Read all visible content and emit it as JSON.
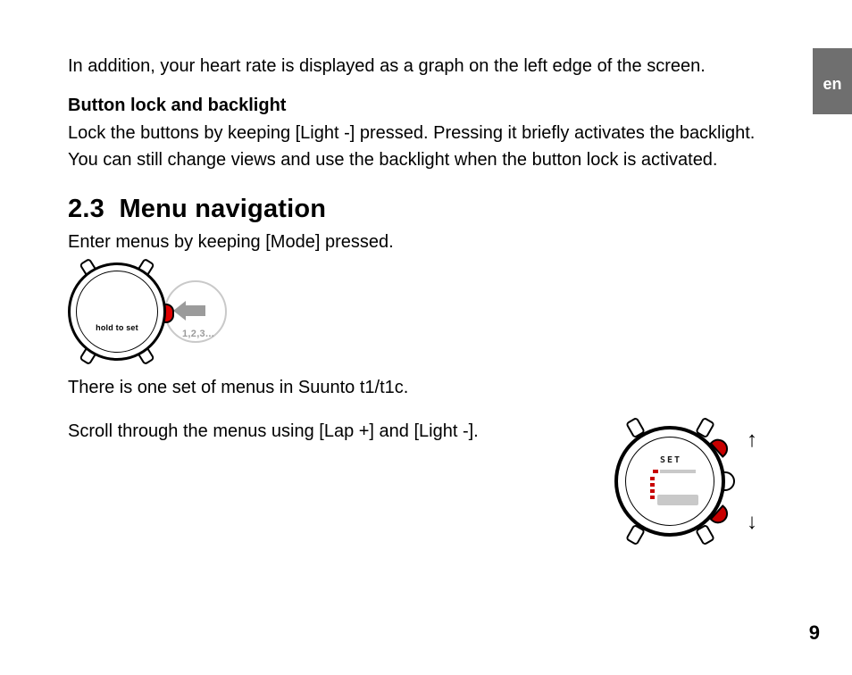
{
  "lang_tab": "en",
  "intro_paragraph": "In addition, your heart rate is displayed as a graph on the left edge of the screen.",
  "section_a": {
    "heading": "Button lock and backlight",
    "body": "Lock the buttons by keeping [Light -] pressed. Pressing it briefly activates the backlight. You can still change views and use the backlight when the button lock is activated."
  },
  "section_b": {
    "number": "2.3",
    "title": "Menu navigation",
    "p1": "Enter menus by keeping [Mode] pressed.",
    "p2": "There is one set of menus in Suunto t1/t1c.",
    "p3": "Scroll through the menus using [Lap +] and [Light -]."
  },
  "figure1": {
    "watch_label": "hold to set",
    "press_label": "1,2,3..."
  },
  "figure2": {
    "screen_word": "SET",
    "arrow_up": "↑",
    "arrow_down": "↓"
  },
  "page_number": "9"
}
